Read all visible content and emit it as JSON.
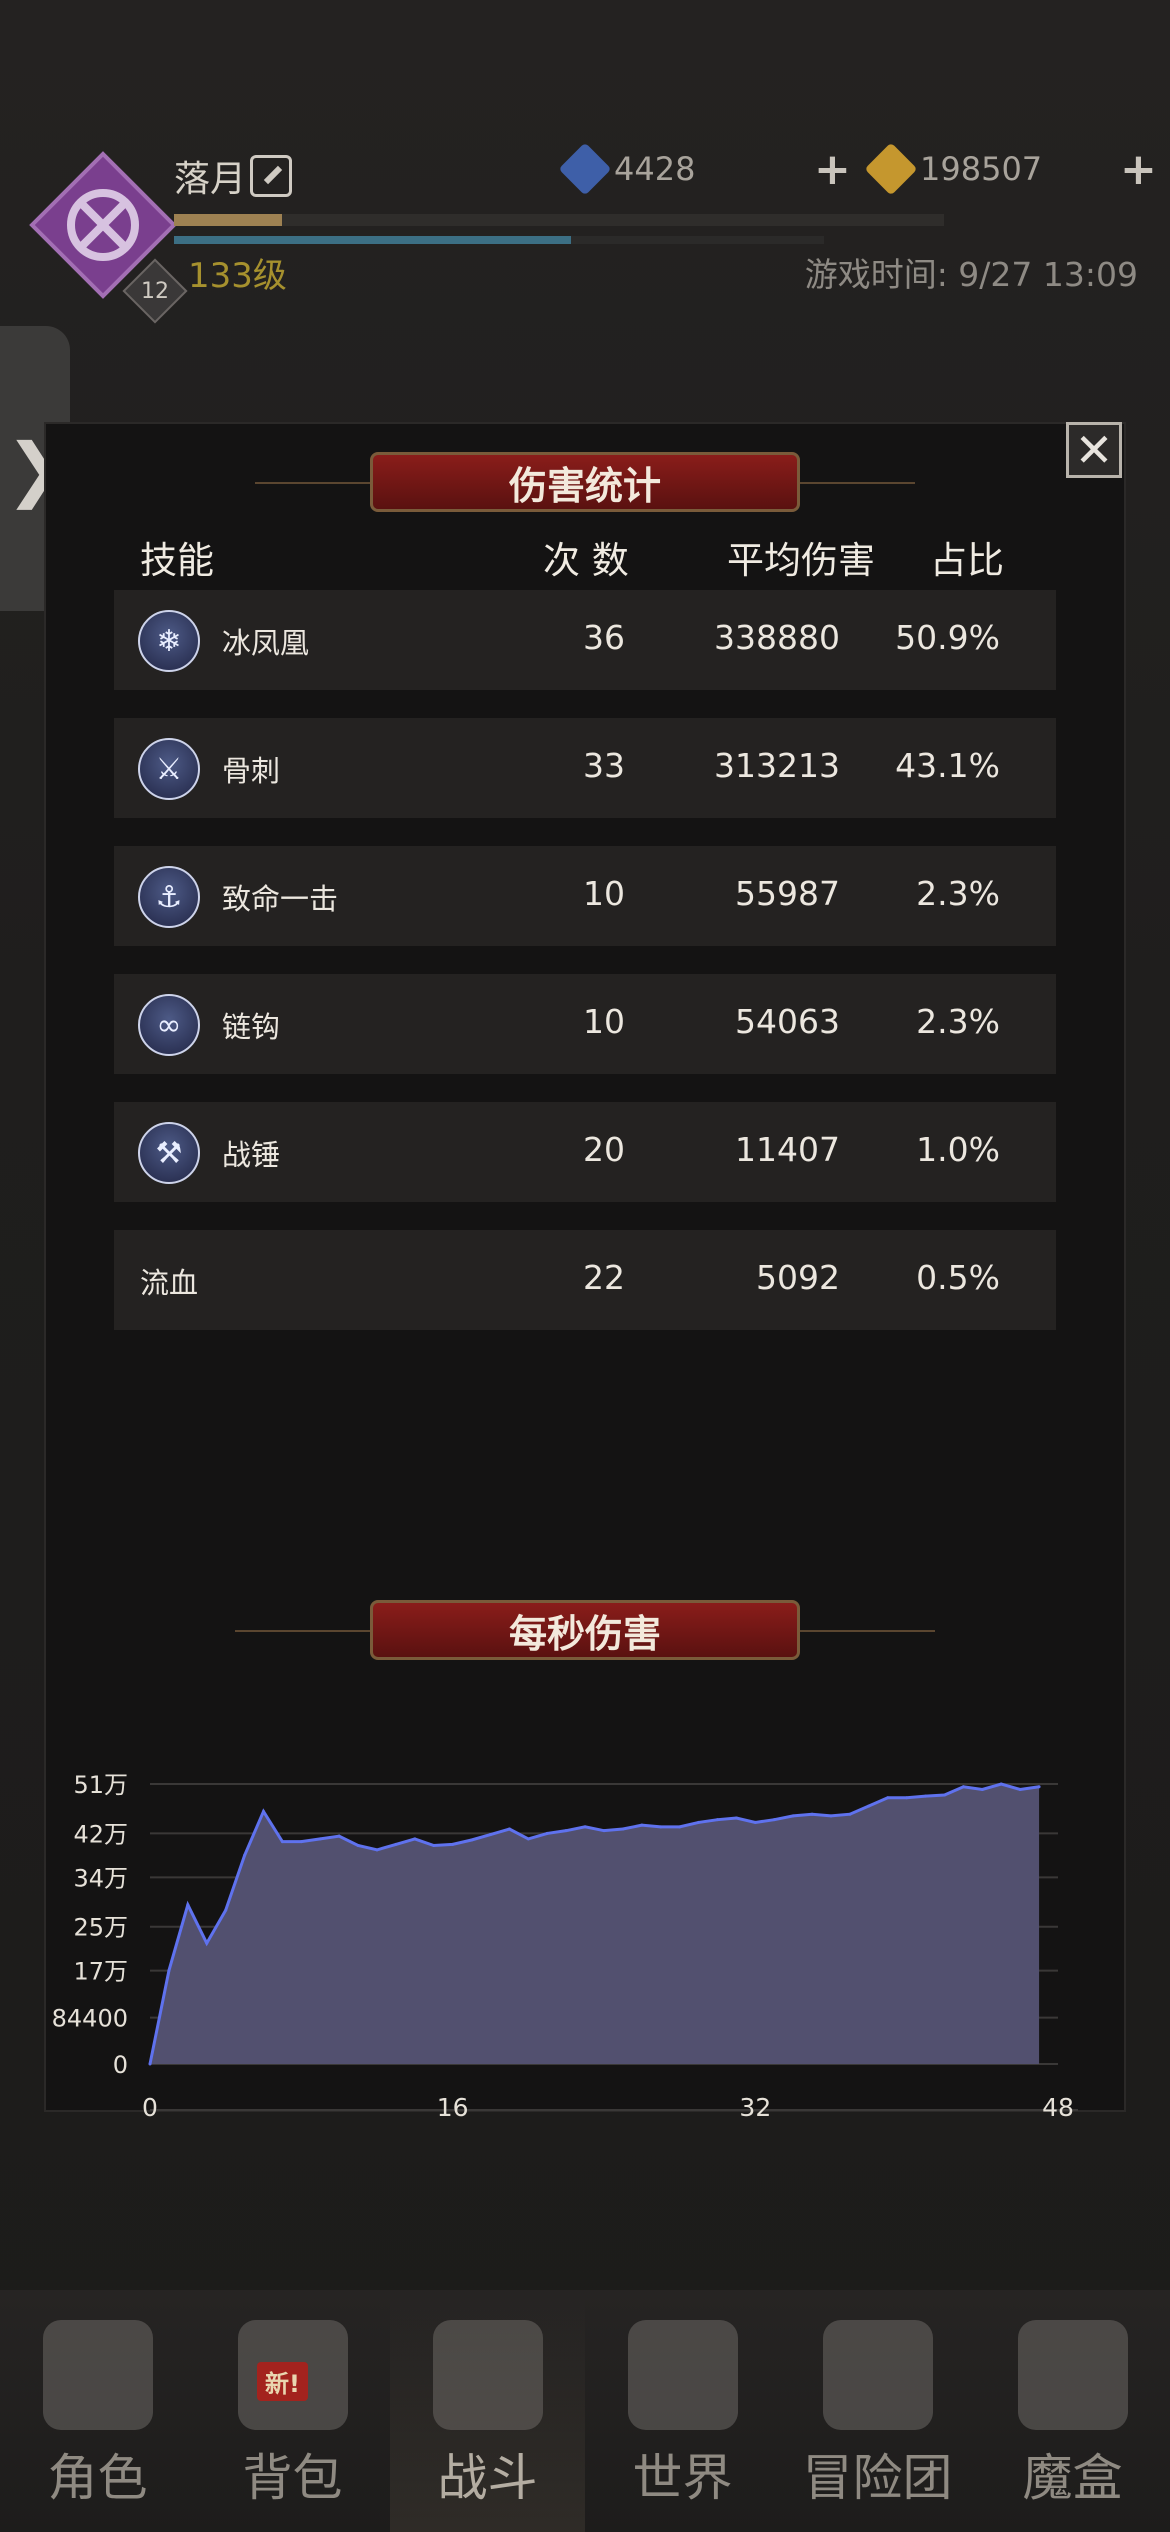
{
  "player": {
    "name": "落月",
    "level": "133级",
    "avatar_badge": "12",
    "game_time": "游戏时间: 9/27 13:09",
    "xp_fraction": 0.14,
    "mp_fraction": 0.61
  },
  "currencies": [
    {
      "name": "diamond",
      "value": "4428",
      "color": "#3e5fa8"
    },
    {
      "name": "gold",
      "value": "198507",
      "color": "#c5972e"
    }
  ],
  "side_tab": {
    "label": "❯"
  },
  "modal": {
    "title": "伤害统计",
    "close_label": "✕",
    "columns": {
      "skill": "技能",
      "count": "次 数",
      "avg": "平均伤害",
      "share": "占比"
    },
    "rows": [
      {
        "icon": "ice-phoenix-icon",
        "glyph": "❄",
        "name": "冰凤凰",
        "count": "36",
        "avg": "338880",
        "share": "50.9%"
      },
      {
        "icon": "sword-icon",
        "glyph": "⚔",
        "name": "骨刺",
        "count": "33",
        "avg": "313213",
        "share": "43.1%"
      },
      {
        "icon": "anchor-icon",
        "glyph": "⚓",
        "name": "致命一击",
        "count": "10",
        "avg": "55987",
        "share": "2.3%"
      },
      {
        "icon": "chain-hook-icon",
        "glyph": "∞",
        "name": "链钩",
        "count": "10",
        "avg": "54063",
        "share": "2.3%"
      },
      {
        "icon": "war-hammer-icon",
        "glyph": "⚒",
        "name": "战锤",
        "count": "20",
        "avg": "11407",
        "share": "1.0%"
      },
      {
        "icon": null,
        "glyph": "",
        "name": "流血",
        "count": "22",
        "avg": "5092",
        "share": "0.5%"
      }
    ],
    "dps_title": "每秒伤害"
  },
  "chart_data": {
    "type": "area",
    "title": "每秒伤害",
    "xlabel": "",
    "ylabel": "",
    "x_ticks": [
      "0",
      "16",
      "32",
      "48"
    ],
    "y_ticks": [
      {
        "label": "0",
        "value": 0
      },
      {
        "label": "84400",
        "value": 84400
      },
      {
        "label": "17万",
        "value": 170000
      },
      {
        "label": "25万",
        "value": 250000
      },
      {
        "label": "34万",
        "value": 340000
      },
      {
        "label": "42万",
        "value": 420000
      },
      {
        "label": "51万",
        "value": 510000
      }
    ],
    "xlim": [
      0,
      48
    ],
    "ylim": [
      0,
      510000
    ],
    "grid": true,
    "fill_color": "#52506f",
    "line_color": "#5f72ee",
    "x": [
      0,
      1,
      2,
      3,
      4,
      5,
      6,
      7,
      8,
      9,
      10,
      11,
      12,
      13,
      14,
      15,
      16,
      17,
      18,
      19,
      20,
      21,
      22,
      23,
      24,
      25,
      26,
      27,
      28,
      29,
      30,
      31,
      32,
      33,
      34,
      35,
      36,
      37,
      38,
      39,
      40,
      41,
      42,
      43,
      44,
      45,
      46,
      47
    ],
    "values": [
      0,
      170000,
      290000,
      220000,
      280000,
      380000,
      460000,
      405000,
      405000,
      410000,
      415000,
      398000,
      390000,
      400000,
      410000,
      398000,
      400000,
      408000,
      418000,
      428000,
      410000,
      420000,
      425000,
      432000,
      425000,
      428000,
      435000,
      432000,
      432000,
      440000,
      445000,
      448000,
      440000,
      445000,
      452000,
      455000,
      452000,
      455000,
      470000,
      485000,
      485000,
      488000,
      490000,
      505000,
      500000,
      510000,
      500000,
      505000
    ]
  },
  "bottom_nav": [
    {
      "name": "nav-character",
      "label": "角色",
      "active": false,
      "badge": ""
    },
    {
      "name": "nav-backpack",
      "label": "背包",
      "active": false,
      "badge": "新!"
    },
    {
      "name": "nav-battle",
      "label": "战斗",
      "active": true,
      "badge": ""
    },
    {
      "name": "nav-world",
      "label": "世界",
      "active": false,
      "badge": ""
    },
    {
      "name": "nav-adventure-group",
      "label": "冒险团",
      "active": false,
      "badge": ""
    },
    {
      "name": "nav-magic-box",
      "label": "魔盒",
      "active": false,
      "badge": ""
    }
  ]
}
